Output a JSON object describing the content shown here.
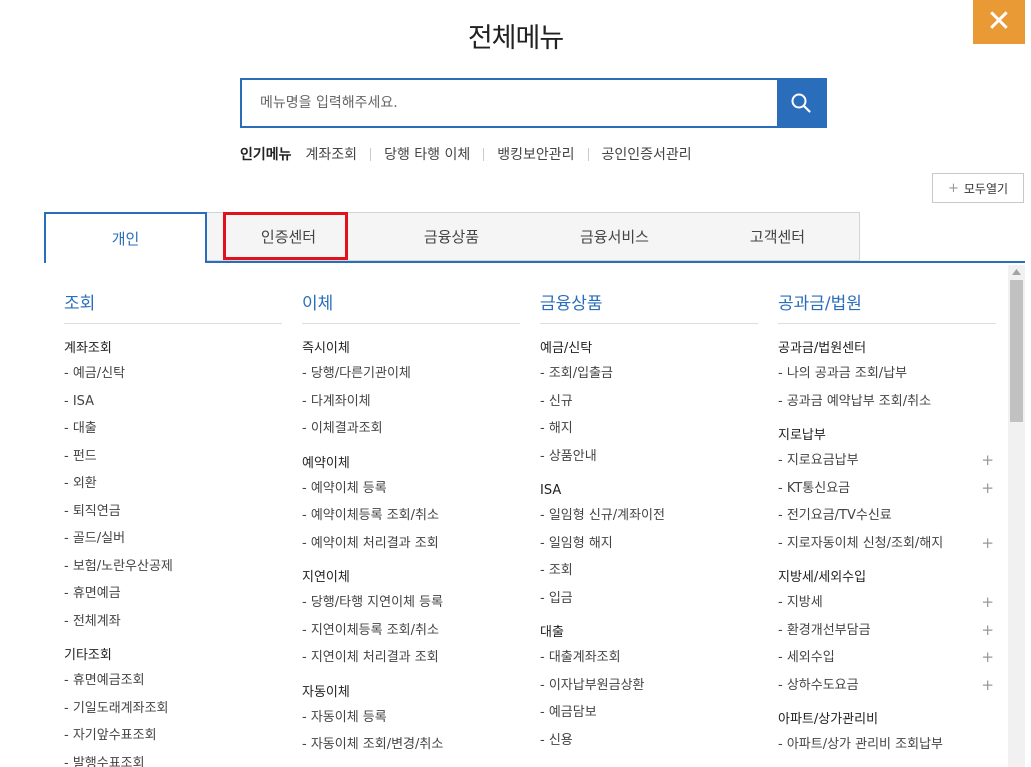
{
  "title": "전체메뉴",
  "close_label": "✕",
  "search": {
    "placeholder": "메뉴명을 입력해주세요."
  },
  "popular": {
    "label": "인기메뉴",
    "links": [
      "계좌조회",
      "당행 타행 이체",
      "뱅킹보안관리",
      "공인인증서관리"
    ]
  },
  "expand_all_label": "모두열기",
  "tabs": [
    "개인",
    "인증센터",
    "금융상품",
    "금융서비스",
    "고객센터"
  ],
  "active_tab": "개인",
  "columns": [
    {
      "title": "조회",
      "groups": [
        {
          "title": "계좌조회",
          "items": [
            {
              "label": "- 예금/신탁"
            },
            {
              "label": "- ISA"
            },
            {
              "label": "- 대출"
            },
            {
              "label": "- 펀드"
            },
            {
              "label": "- 외환"
            },
            {
              "label": "- 퇴직연금"
            },
            {
              "label": "- 골드/실버"
            },
            {
              "label": "- 보험/노란우산공제"
            },
            {
              "label": "- 휴면예금"
            },
            {
              "label": "- 전체계좌"
            }
          ]
        },
        {
          "title": "기타조회",
          "items": [
            {
              "label": "- 휴면예금조회"
            },
            {
              "label": "- 기일도래계좌조회"
            },
            {
              "label": "- 자기앞수표조회"
            },
            {
              "label": "- 발행수표조회"
            }
          ]
        }
      ]
    },
    {
      "title": "이체",
      "groups": [
        {
          "title": "즉시이체",
          "items": [
            {
              "label": "- 당행/다른기관이체"
            },
            {
              "label": "- 다계좌이체"
            },
            {
              "label": "- 이체결과조회"
            }
          ]
        },
        {
          "title": "예약이체",
          "items": [
            {
              "label": "- 예약이체 등록"
            },
            {
              "label": "- 예약이체등록 조회/취소"
            },
            {
              "label": "- 예약이체 처리결과 조회"
            }
          ]
        },
        {
          "title": "지연이체",
          "items": [
            {
              "label": "- 당행/타행 지연이체 등록"
            },
            {
              "label": "- 지연이체등록 조회/취소"
            },
            {
              "label": "- 지연이체 처리결과 조회"
            }
          ]
        },
        {
          "title": "자동이체",
          "items": [
            {
              "label": "- 자동이체 등록"
            },
            {
              "label": "- 자동이체 조회/변경/취소"
            }
          ]
        }
      ]
    },
    {
      "title": "금융상품",
      "groups": [
        {
          "title": "예금/신탁",
          "items": [
            {
              "label": "- 조회/입출금"
            },
            {
              "label": "- 신규"
            },
            {
              "label": "- 해지"
            },
            {
              "label": "- 상품안내"
            }
          ]
        },
        {
          "title": "ISA",
          "items": [
            {
              "label": "- 일임형 신규/계좌이전"
            },
            {
              "label": "- 일임형 해지"
            },
            {
              "label": "- 조회"
            },
            {
              "label": "- 입금"
            }
          ]
        },
        {
          "title": "대출",
          "items": [
            {
              "label": "- 대출계좌조회"
            },
            {
              "label": "- 이자납부원금상환"
            },
            {
              "label": "- 예금담보"
            },
            {
              "label": "- 신용"
            }
          ]
        }
      ]
    },
    {
      "title": "공과금/법원",
      "groups": [
        {
          "title": "공과금/법원센터",
          "items": [
            {
              "label": "- 나의 공과금 조회/납부"
            },
            {
              "label": "- 공과금 예약납부 조회/취소"
            }
          ]
        },
        {
          "title": "지로납부",
          "items": [
            {
              "label": "- 지로요금납부",
              "expand": "+"
            },
            {
              "label": "- KT통신요금",
              "expand": "+"
            },
            {
              "label": "- 전기요금/TV수신료"
            },
            {
              "label": "- 지로자동이체 신청/조회/해지",
              "expand": "+"
            }
          ]
        },
        {
          "title": "지방세/세외수입",
          "items": [
            {
              "label": "- 지방세",
              "expand": "+"
            },
            {
              "label": "- 환경개선부담금",
              "expand": "+"
            },
            {
              "label": "- 세외수입",
              "expand": "+"
            },
            {
              "label": "- 상하수도요금",
              "expand": "+"
            }
          ]
        },
        {
          "title": "아파트/상가관리비",
          "items": [
            {
              "label": "- 아파트/상가 관리비 조회납부"
            }
          ]
        }
      ]
    }
  ]
}
